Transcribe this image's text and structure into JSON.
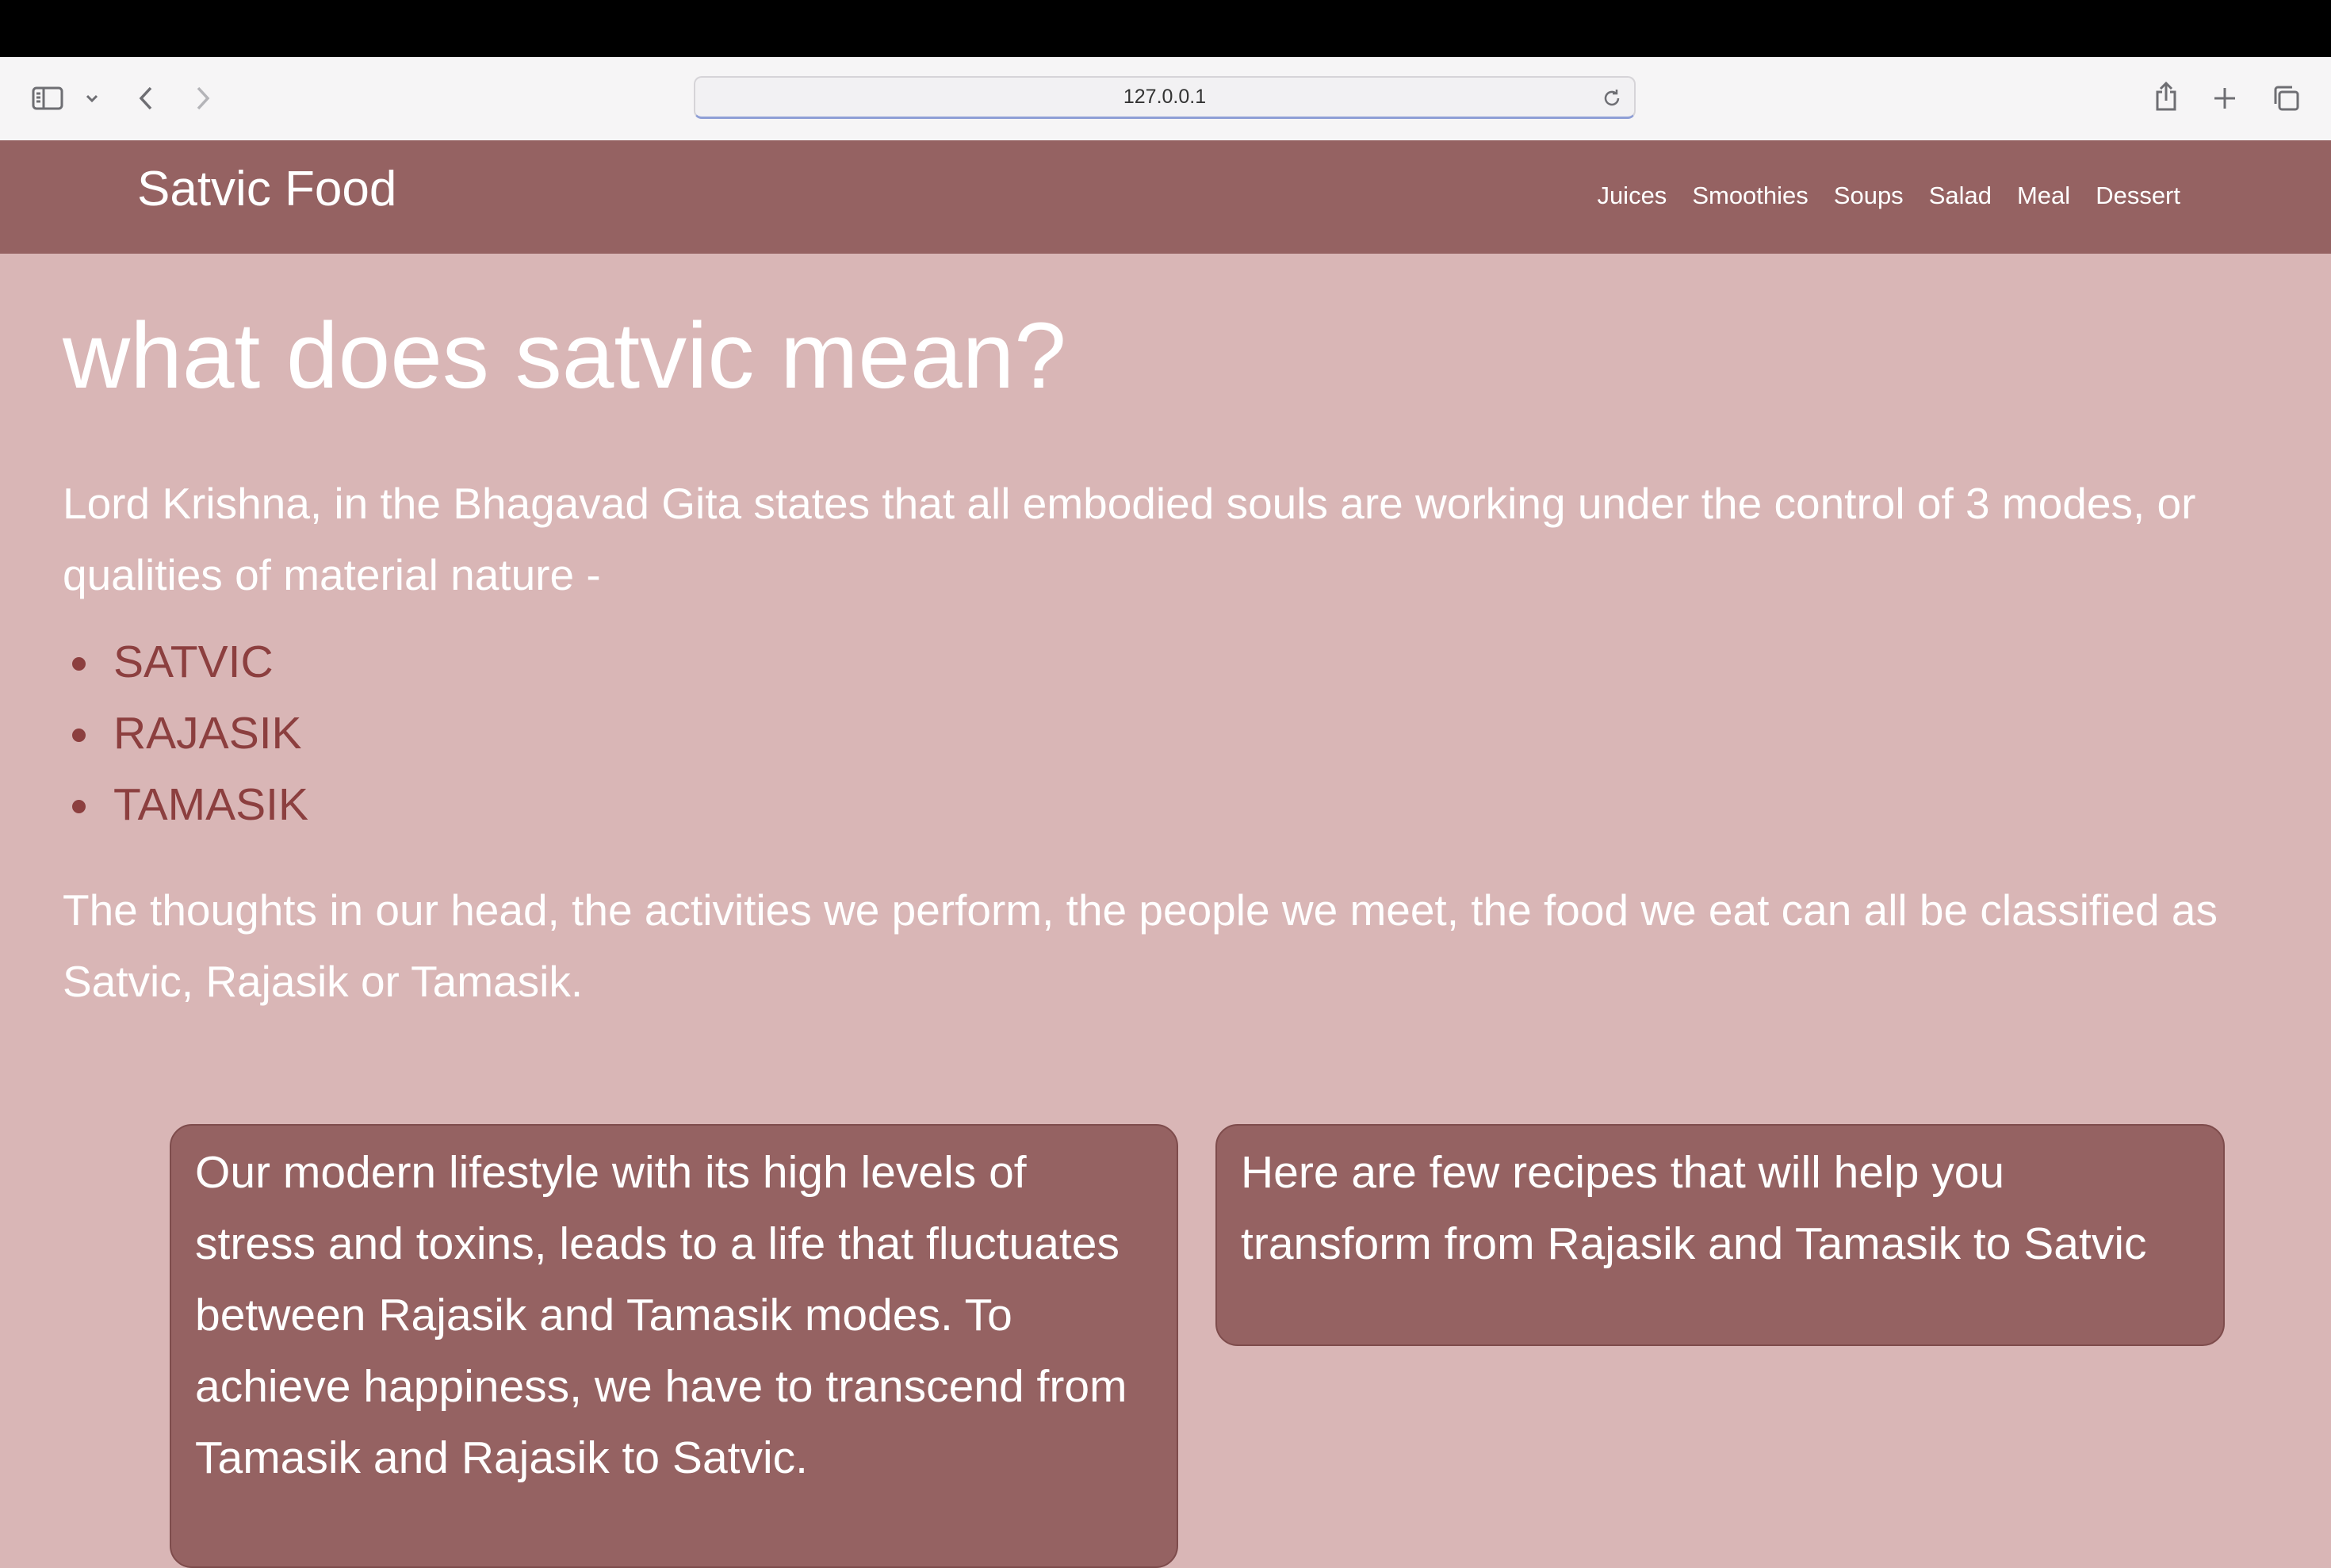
{
  "browser": {
    "url": "127.0.0.1"
  },
  "site": {
    "brand": "Satvic Food",
    "nav": [
      "Juices",
      "Smoothies",
      "Soups",
      "Salad",
      "Meal",
      "Dessert"
    ]
  },
  "content": {
    "heading": "what does satvic mean?",
    "intro": "Lord Krishna, in the Bhagavad Gita states that all embodied souls are working under the control of 3 modes, or qualities of material nature -",
    "modes": [
      "SATVIC",
      "RAJASIK",
      "TAMASIK"
    ],
    "summary": "The thoughts in our head, the activities we perform, the people we meet, the food we eat can all be classified as Satvic, Rajasik or Tamasik.",
    "card_left": "Our modern lifestyle with its high levels of stress and toxins, leads to a life that fluctuates between Rajasik and Tamasik modes. To achieve happiness, we have to transcend from Tamasik and Rajasik to Satvic.",
    "card_right": "Here are few recipes that will help you transform from Rajasik and Tamasik to Satvic"
  },
  "icons": {
    "toolbar": [
      "sidebar-icon",
      "chevron-down-icon",
      "back-icon",
      "forward-icon",
      "reload-icon",
      "share-icon",
      "new-tab-icon",
      "tab-overview-icon"
    ]
  },
  "colors": {
    "page_background": "#d9b6b6",
    "header_background": "#956262",
    "list_text": "#8c3f3f",
    "card_background": "#956262"
  }
}
